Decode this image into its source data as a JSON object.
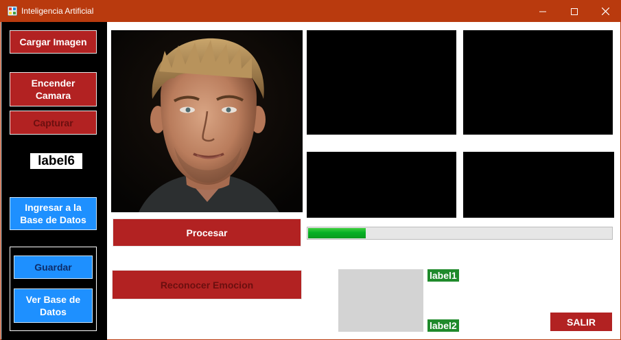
{
  "window": {
    "title": "Inteligencia Artificial",
    "accent_color": "#b93a0e",
    "controls": [
      "minimize-icon",
      "maximize-icon",
      "close-icon"
    ]
  },
  "sidebar": {
    "cargar_imagen": "Cargar Imagen",
    "encender_camara": "Encender\nCamara",
    "capturar": "Capturar",
    "label6": "label6",
    "ingresar_bd": "Ingresar a la\nBase de Datos",
    "guardar": "Guardar",
    "ver_bd": "Ver Base de\nDatos"
  },
  "main": {
    "procesar": "Procesar",
    "reconocer_emocion": "Reconocer Emocion",
    "progress_fraction": 0.19,
    "label1": "label1",
    "label2": "label2",
    "salir": "SALIR"
  },
  "colors": {
    "red_button": "#b22222",
    "blue_button": "#1e90ff",
    "green_label": "#1f8a2b",
    "progress_fill": "#06b025"
  }
}
